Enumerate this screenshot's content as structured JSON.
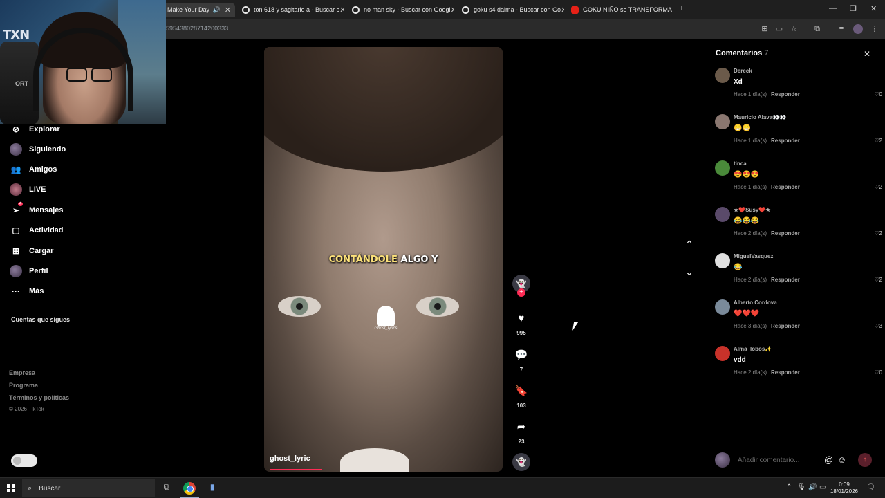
{
  "browser": {
    "tabs": [
      {
        "title": "Make Your Day",
        "icon": "speaker-icon",
        "active": true
      },
      {
        "title": "ton 618 y sagitario a - Buscar c",
        "icon": "google-icon"
      },
      {
        "title": "no man sky - Buscar con Googl",
        "icon": "google-icon"
      },
      {
        "title": "goku s4 daima - Buscar con Go",
        "icon": "google-icon"
      },
      {
        "title": "GOKU NIÑO se TRANSFORMA",
        "icon": "youtube-icon"
      }
    ],
    "new_tab": "+",
    "url_fragment": "595438028714200333"
  },
  "sidebar": {
    "items": [
      {
        "label": "Explorar",
        "icon": "compass-icon"
      },
      {
        "label": "Siguiendo",
        "icon": "avatar"
      },
      {
        "label": "Amigos",
        "icon": "friends-icon"
      },
      {
        "label": "LIVE",
        "icon": "live-avatar"
      },
      {
        "label": "Mensajes",
        "icon": "message-icon",
        "badge": "4"
      },
      {
        "label": "Actividad",
        "icon": "activity-icon"
      },
      {
        "label": "Cargar",
        "icon": "upload-icon"
      },
      {
        "label": "Perfil",
        "icon": "profile-avatar"
      },
      {
        "label": "Más",
        "icon": "more-icon"
      }
    ],
    "follows_title": "Cuentas que sigues",
    "footer_links": [
      "Empresa",
      "Programa",
      "Términos y políticas"
    ],
    "copyright": "© 2026 TikTok"
  },
  "webcam": {
    "logo": "TXN",
    "chair_label": "ORT"
  },
  "video": {
    "caption_highlight": "CONTÁNDOLE",
    "caption_rest": " ALGO Y",
    "watermark": "Ghost_lyrics",
    "author": "ghost_lyric",
    "progress": 0.22
  },
  "actions": {
    "likes": "995",
    "comments": "7",
    "saves": "103",
    "shares": "23"
  },
  "comments_panel": {
    "title": "Comentarios",
    "count": "7",
    "reply_label": "Responder",
    "items": [
      {
        "user": "Dereck",
        "text": "Xd",
        "time": "Hace 1 día(s)",
        "likes": "0",
        "avatar_color": "#6b5a4a"
      },
      {
        "user": "Mauricio Alava👀👀",
        "text": "😁😁",
        "time": "Hace 1 día(s)",
        "likes": "2",
        "avatar_color": "#8a7770"
      },
      {
        "user": "tinca",
        "text": "😍😍😍",
        "time": "Hace 1 día(s)",
        "likes": "2",
        "avatar_color": "#4a8a3a"
      },
      {
        "user": "★❤️Susy❤️★",
        "text": "😂😂😂",
        "time": "Hace 2 día(s)",
        "likes": "2",
        "avatar_color": "#5a4a6a"
      },
      {
        "user": "MiguelVasquez",
        "text": "😂",
        "time": "Hace 2 día(s)",
        "likes": "2",
        "avatar_color": "#e0e0e0"
      },
      {
        "user": "Alberto Cordova",
        "text": "❤️❤️❤️",
        "time": "Hace 3 día(s)",
        "likes": "3",
        "avatar_color": "#7a8a9a"
      },
      {
        "user": "Alma_lobos✨",
        "text": "vdd",
        "time": "Hace 2 día(s)",
        "likes": "0",
        "avatar_color": "#c8322a"
      }
    ],
    "add_placeholder": "Añadir comentario..."
  },
  "taskbar": {
    "search_label": "Buscar",
    "time": "0:09",
    "date": "18/01/2026"
  }
}
